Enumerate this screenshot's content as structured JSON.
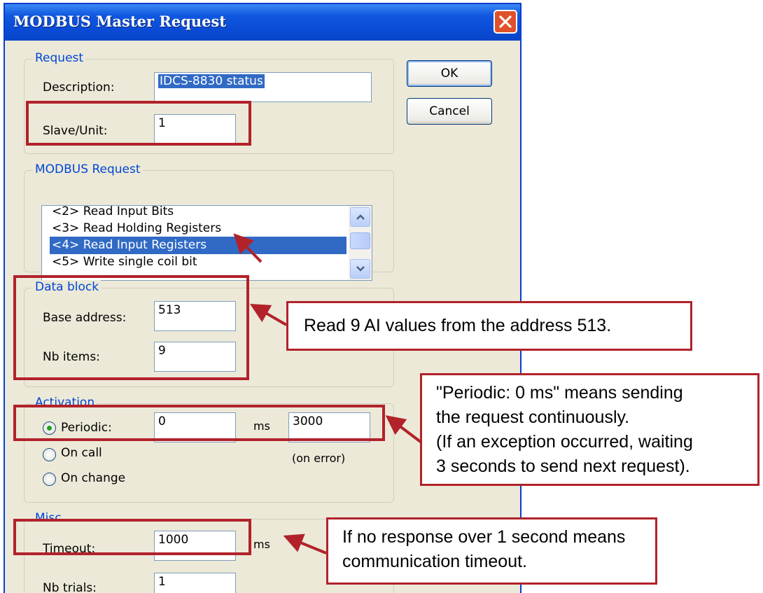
{
  "dialog": {
    "title": "MODBUS Master Request",
    "close_icon": "close-icon"
  },
  "buttons": {
    "ok": "OK",
    "cancel": "Cancel"
  },
  "request": {
    "legend": "Request",
    "description_label": "Description:",
    "description_value": "IDCS-8830 status",
    "slave_label": "Slave/Unit:",
    "slave_value": "1"
  },
  "modbus_request": {
    "legend": "MODBUS Request",
    "items": [
      "<2> Read Input Bits",
      "<3> Read Holding Registers",
      "<4> Read Input Registers",
      "<5> Write single coil bit"
    ],
    "selected_index": 2
  },
  "data_block": {
    "legend": "Data block",
    "base_address_label": "Base address:",
    "base_address_value": "513",
    "nb_items_label": "Nb items:",
    "nb_items_value": "9"
  },
  "activation": {
    "legend": "Activation",
    "periodic_label": "Periodic:",
    "periodic_value": "0",
    "periodic_unit": "ms",
    "error_value": "3000",
    "error_note": "(on error)",
    "on_call_label": "On call",
    "on_change_label": "On change",
    "selected": "periodic"
  },
  "misc": {
    "legend": "Misc.",
    "timeout_label": "Timeout:",
    "timeout_value": "1000",
    "timeout_unit": "ms",
    "nb_trials_label": "Nb trials:",
    "nb_trials_value": "1"
  },
  "callouts": {
    "data_block": "Read 9 AI values from the address 513.",
    "periodic": [
      "\"Periodic: 0 ms\" means sending",
      "the request continuously.",
      "(If an exception occurred, waiting",
      "3 seconds to send next request)."
    ],
    "timeout": [
      "If no response over 1 second means",
      "communication timeout."
    ]
  },
  "colors": {
    "annotation": "#B2222A",
    "titlebar": "#0A4BD6",
    "selection": "#316AC5",
    "legend": "#0046D5"
  }
}
